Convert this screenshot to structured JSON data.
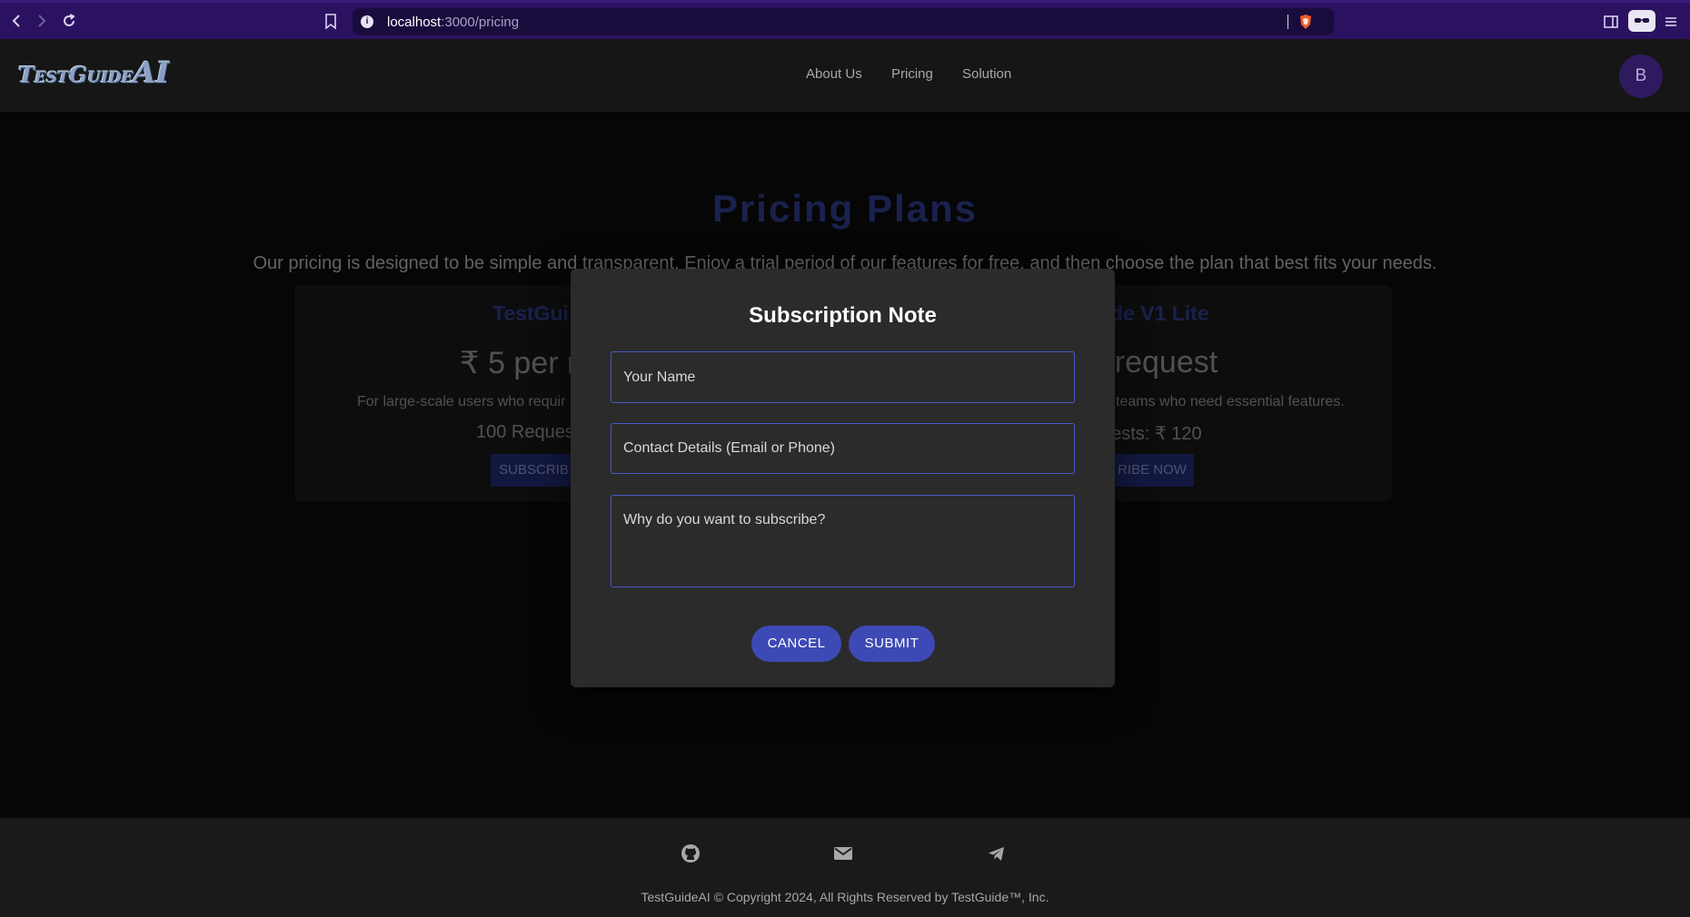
{
  "browser": {
    "url_host": "localhost",
    "url_path": ":3000/pricing"
  },
  "header": {
    "logo_text": "TestGuide",
    "logo_ai": "AI",
    "nav": [
      "About Us",
      "Pricing",
      "Solution"
    ],
    "avatar_initial": "B"
  },
  "main": {
    "title": "Pricing Plans",
    "subtitle": "Our pricing is designed to be simple and transparent. Enjoy a trial period of our features for free, and then choose the plan that best fits your needs.",
    "cards": [
      {
        "name": "TestGui",
        "price": "₹ 5 per r",
        "desc": "For large-scale users who requir",
        "requests": "100 Reques",
        "button": "SUBSCRIB"
      },
      {
        "name": "de V1 Lite",
        "price": "r request",
        "desc": "teams who need essential features.",
        "requests": "uests: ₹ 120",
        "button": "RIBE NOW"
      }
    ]
  },
  "modal": {
    "title": "Subscription Note",
    "name_placeholder": "Your Name",
    "contact_placeholder": "Contact Details (Email or Phone)",
    "reason_placeholder": "Why do you want to subscribe?",
    "cancel": "CANCEL",
    "submit": "SUBMIT"
  },
  "footer": {
    "icons": [
      "github-icon",
      "email-icon",
      "telegram-icon"
    ],
    "copyright": "TestGuideAI © Copyright 2024, All Rights Reserved by TestGuide™, Inc."
  },
  "colors": {
    "chrome": "#2a1260",
    "accent": "#3d4ab6",
    "title_blue": "#2c3a86"
  }
}
